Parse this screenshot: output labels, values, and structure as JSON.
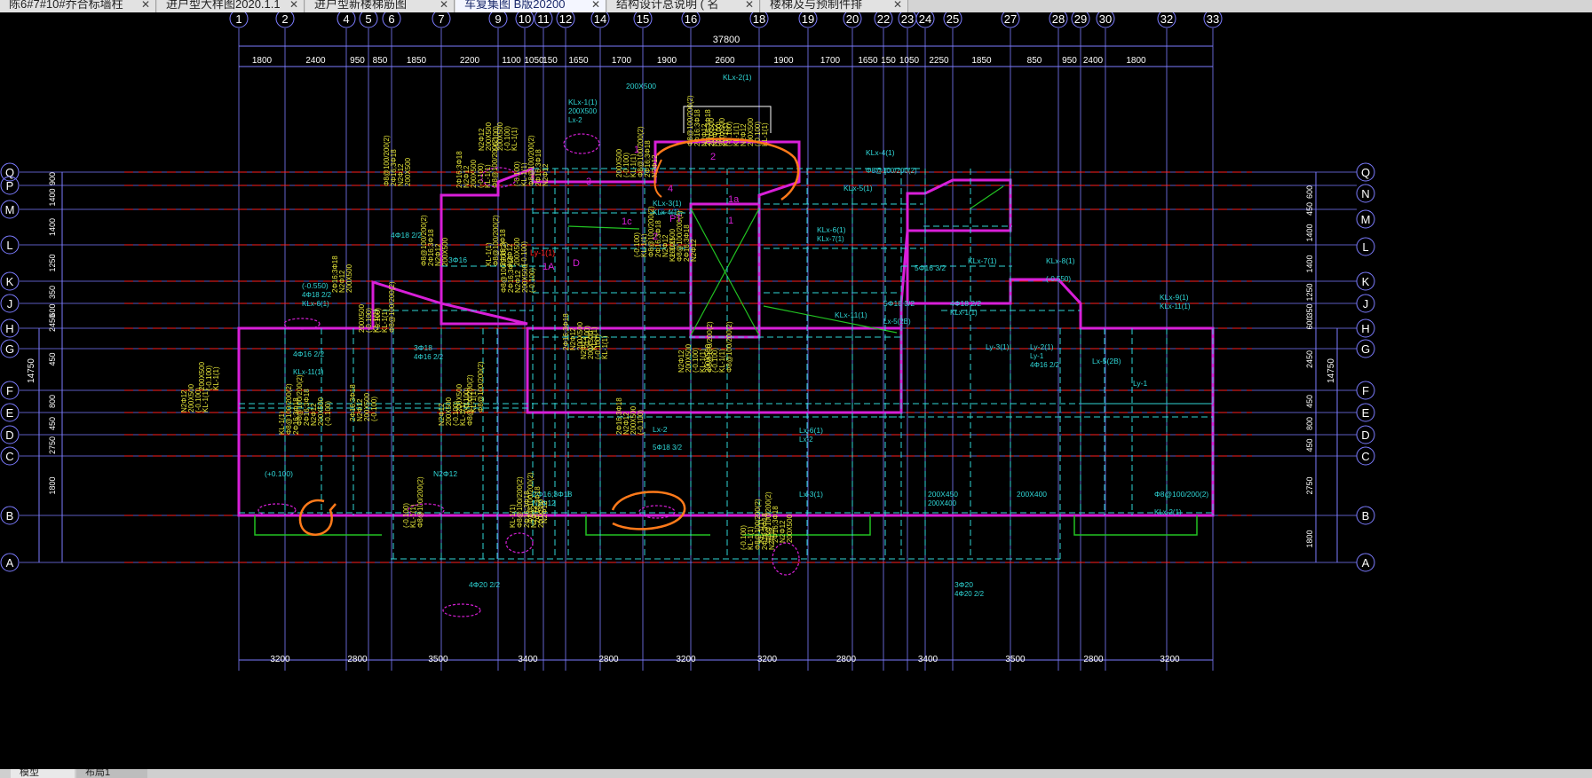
{
  "tabs": [
    {
      "label": "陈6#7#10#乔合标墙柱",
      "active": false
    },
    {
      "label": "进户型大样图2020.1.1",
      "active": false
    },
    {
      "label": "进户型新楼梯筋图",
      "active": false
    },
    {
      "label": "车复集图 B版20200",
      "active": true
    },
    {
      "label": "结构设计总说明 ( 名",
      "active": false
    },
    {
      "label": "楼梯及与预制件排",
      "active": false
    }
  ],
  "grid": {
    "top_axes": [
      "1",
      "2",
      "4",
      "5",
      "6",
      "7",
      "9",
      "10",
      "11",
      "12",
      "14",
      "15",
      "16",
      "18",
      "19",
      "20",
      "22",
      "23",
      "24",
      "25",
      "27",
      "28",
      "29",
      "30",
      "32",
      "33"
    ],
    "top_dims": [
      "1800",
      "2400",
      "950",
      "850",
      "1850",
      "2200",
      "1100",
      "1050",
      "150",
      "1650",
      "1700",
      "1900",
      "2600",
      "1900",
      "1700",
      "1650",
      "150",
      "1050",
      "2250",
      "1850",
      "850",
      "950",
      "2400",
      "1800"
    ],
    "total_dim": "37800",
    "bottom_dims": [
      "3200",
      "2800",
      "3500",
      "3400",
      "2800",
      "3200",
      "3200",
      "2800",
      "3400",
      "3500",
      "2800",
      "3200"
    ],
    "left_axes": [
      "Q",
      "P",
      "M",
      "L",
      "K",
      "J",
      "H",
      "G",
      "F",
      "E",
      "D",
      "C",
      "B",
      "A"
    ],
    "right_axes": [
      "Q",
      "N",
      "M",
      "L",
      "K",
      "J",
      "H",
      "G",
      "F",
      "E",
      "D",
      "C",
      "B",
      "A"
    ],
    "left_dims": [
      "900",
      "1400",
      "1400",
      "1250",
      "350",
      "600",
      "2450",
      "450",
      "800",
      "450",
      "2750",
      "1800"
    ],
    "right_dims": [
      "600",
      "450",
      "1400",
      "1400",
      "1250",
      "350",
      "600",
      "2450",
      "450",
      "800",
      "450",
      "2750",
      "1800"
    ],
    "height_label": "14750"
  },
  "annotations": {
    "cyan": [
      "KLx-1(1)",
      "200X500",
      "KLx-2(1)",
      "KLx-3(1)",
      "KLx-4(1)",
      "KLx-5(1)",
      "KLx-6(1)",
      "KLx-7(1)",
      "KLx-8(1)",
      "KLx-9(1)",
      "KLx-11(1)",
      "Ly-3(1)",
      "Ly-2(1)",
      "Ly-1",
      "Lx-5(2B)",
      "Lx-6(1)",
      "Lx-2",
      "Lx-3(1)",
      "200X450",
      "200X400",
      "Φ8@100/200(2)",
      "2Φ16;3Φ18",
      "N2Φ12",
      "(+0.100)",
      "(-0.550)",
      "4Φ18 2/2",
      "3Φ16",
      "3Φ18",
      "4Φ16 2/2",
      "5Φ16 3/2",
      "3Φ20",
      "4Φ20 2/2",
      "5Φ18 3/2",
      "4Φ18 2/2"
    ],
    "magenta": [
      "1",
      "2",
      "3",
      "4",
      "1a",
      "1c",
      "1A",
      "D",
      "PT"
    ],
    "red": [
      "Ly-1(1)"
    ]
  },
  "bottom_tabs": {
    "model": "模型",
    "layout": "布局1"
  },
  "colors": {
    "background": "#000000",
    "axis": "#7c7cff",
    "cyan": "#2fd6d6",
    "yellow": "#e8e83a",
    "magenta": "#d81fd8",
    "red": "#ff2020",
    "orange": "#ff7a1a",
    "green": "#22c322",
    "white": "#ffffff"
  }
}
